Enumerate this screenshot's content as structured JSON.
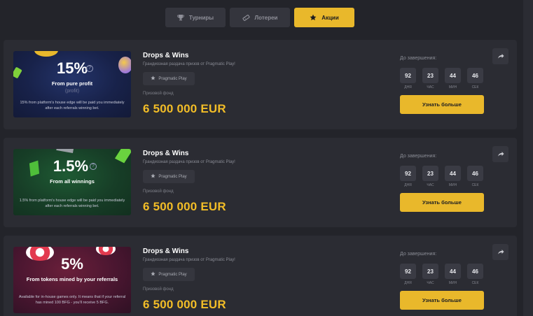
{
  "tabs": [
    {
      "label": "Турниры",
      "icon": "trophy-icon",
      "active": false
    },
    {
      "label": "Лотереи",
      "icon": "ticket-icon",
      "active": false
    },
    {
      "label": "Акции",
      "icon": "star-icon",
      "active": true
    }
  ],
  "colors": {
    "accent": "#e9b82b",
    "card_bg": "#2b2c33",
    "page_bg": "#23242a"
  },
  "promos": [
    {
      "banner": {
        "percent": "15%",
        "subtitle": "From pure profit",
        "subtitle2": "(profit)",
        "description": "15% from platform's house edge will be paid you immediately after each referrals winning bet."
      },
      "title": "Drops & Wins",
      "subtitle": "Грандиозная раздача призов от Pragmatic Play!",
      "provider": "Pragmatic Play",
      "fund_label": "Призовой фонд",
      "fund_value": "6 500 000 EUR",
      "until_label": "До завершения:",
      "countdown": [
        {
          "value": "92",
          "label": "ДНЯ"
        },
        {
          "value": "23",
          "label": "ЧАС"
        },
        {
          "value": "44",
          "label": "МИН"
        },
        {
          "value": "46",
          "label": "СЕК"
        }
      ],
      "more_label": "Узнать больше"
    },
    {
      "banner": {
        "percent": "1.5%",
        "subtitle": "From all winnings",
        "subtitle2": "",
        "description": "1.5% from platform's house edge will be paid you immediately after each referrals winning bet."
      },
      "title": "Drops & Wins",
      "subtitle": "Грандиозная раздача призов от Pragmatic Play!",
      "provider": "Pragmatic Play",
      "fund_label": "Призовой фонд",
      "fund_value": "6 500 000 EUR",
      "until_label": "До завершения:",
      "countdown": [
        {
          "value": "92",
          "label": "ДНЯ"
        },
        {
          "value": "23",
          "label": "ЧАС"
        },
        {
          "value": "44",
          "label": "МИН"
        },
        {
          "value": "46",
          "label": "СЕК"
        }
      ],
      "more_label": "Узнать больше"
    },
    {
      "banner": {
        "percent": "5%",
        "subtitle": "From tokens mined by your referrals",
        "subtitle2": "",
        "description": "Available for in-house games only. It means that if your referral has mined 100 BFG - you'll receive 5 BFG."
      },
      "title": "Drops & Wins",
      "subtitle": "Грандиозная раздача призов от Pragmatic Play!",
      "provider": "Pragmatic Play",
      "fund_label": "Призовой фонд",
      "fund_value": "6 500 000 EUR",
      "until_label": "До завершения:",
      "countdown": [
        {
          "value": "92",
          "label": "ДНЯ"
        },
        {
          "value": "23",
          "label": "ЧАС"
        },
        {
          "value": "44",
          "label": "МИН"
        },
        {
          "value": "46",
          "label": "СЕК"
        }
      ],
      "more_label": "Узнать больше"
    }
  ]
}
